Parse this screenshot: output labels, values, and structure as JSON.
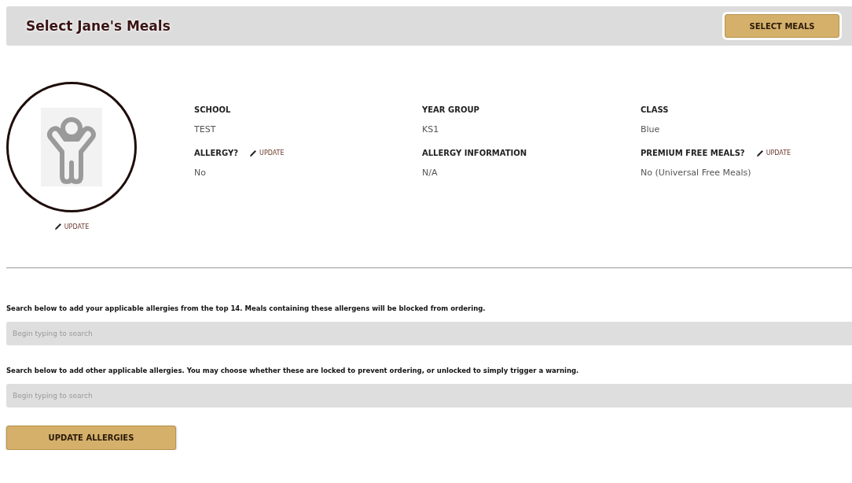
{
  "header": {
    "title": "Select Jane's Meals",
    "button": "SELECT MEALS"
  },
  "profile": {
    "update_link": "UPDATE"
  },
  "details": [
    {
      "label": "SCHOOL",
      "value": "TEST"
    },
    {
      "label": "YEAR GROUP",
      "value": "KS1"
    },
    {
      "label": "CLASS",
      "value": "Blue"
    },
    {
      "label": "ALLERGY?",
      "update_link": "UPDATE",
      "value": "No"
    },
    {
      "label": "ALLERGY INFORMATION",
      "value": "N/A"
    },
    {
      "label": "PREMIUM FREE MEALS?",
      "update_link": "UPDATE",
      "value": "No (Universal Free Meals)"
    }
  ],
  "allergy_searches": [
    {
      "instruction": "Search below to add your applicable allergies from the top 14. Meals containing these allergens will be blocked from ordering.",
      "placeholder": "Begin typing to search"
    },
    {
      "instruction": "Search below to add other applicable allergies. You may choose whether these are locked to prevent ordering, or unlocked to simply trigger a warning.",
      "placeholder": "Begin typing to search"
    }
  ],
  "update_button": "UPDATE ALLERGIES"
}
